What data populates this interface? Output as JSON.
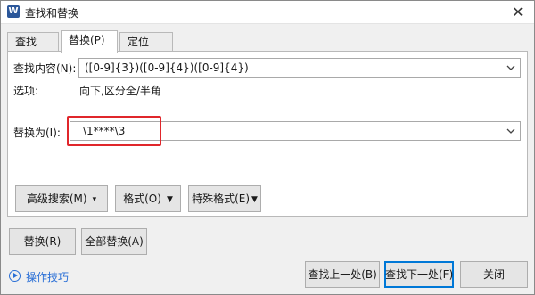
{
  "window": {
    "title": "查找和替换",
    "close_glyph": "✕"
  },
  "app_icon_glyph": "W",
  "tabs": [
    {
      "label": "查找(D)",
      "active": false
    },
    {
      "label": "替换(P)",
      "active": true
    },
    {
      "label": "定位(G)",
      "active": false
    }
  ],
  "find": {
    "label": "查找内容(N):",
    "value": "([0-9]{3})([0-9]{4})([0-9]{4})"
  },
  "options": {
    "label": "选项:",
    "value": "向下,区分全/半角"
  },
  "replace": {
    "label": "替换为(I):",
    "value": "\\1****\\3"
  },
  "buttons": {
    "advanced_search": "高级搜索(M)",
    "format": "格式(O)",
    "special_format": "特殊格式(E)",
    "replace": "替换(R)",
    "replace_all": "全部替换(A)",
    "find_prev": "查找上一处(B)",
    "find_next": "查找下一处(F)",
    "close": "关闭"
  },
  "help": {
    "label": "操作技巧"
  },
  "colors": {
    "highlight_border": "#e0262b",
    "primary_border": "#0078d7",
    "link": "#2a6fd6",
    "app_icon": "#2b579a"
  },
  "icons": {
    "app": "wps-writer-icon",
    "close": "close-icon",
    "dropdown": "chevron-down-icon",
    "help": "play-circle-icon"
  }
}
